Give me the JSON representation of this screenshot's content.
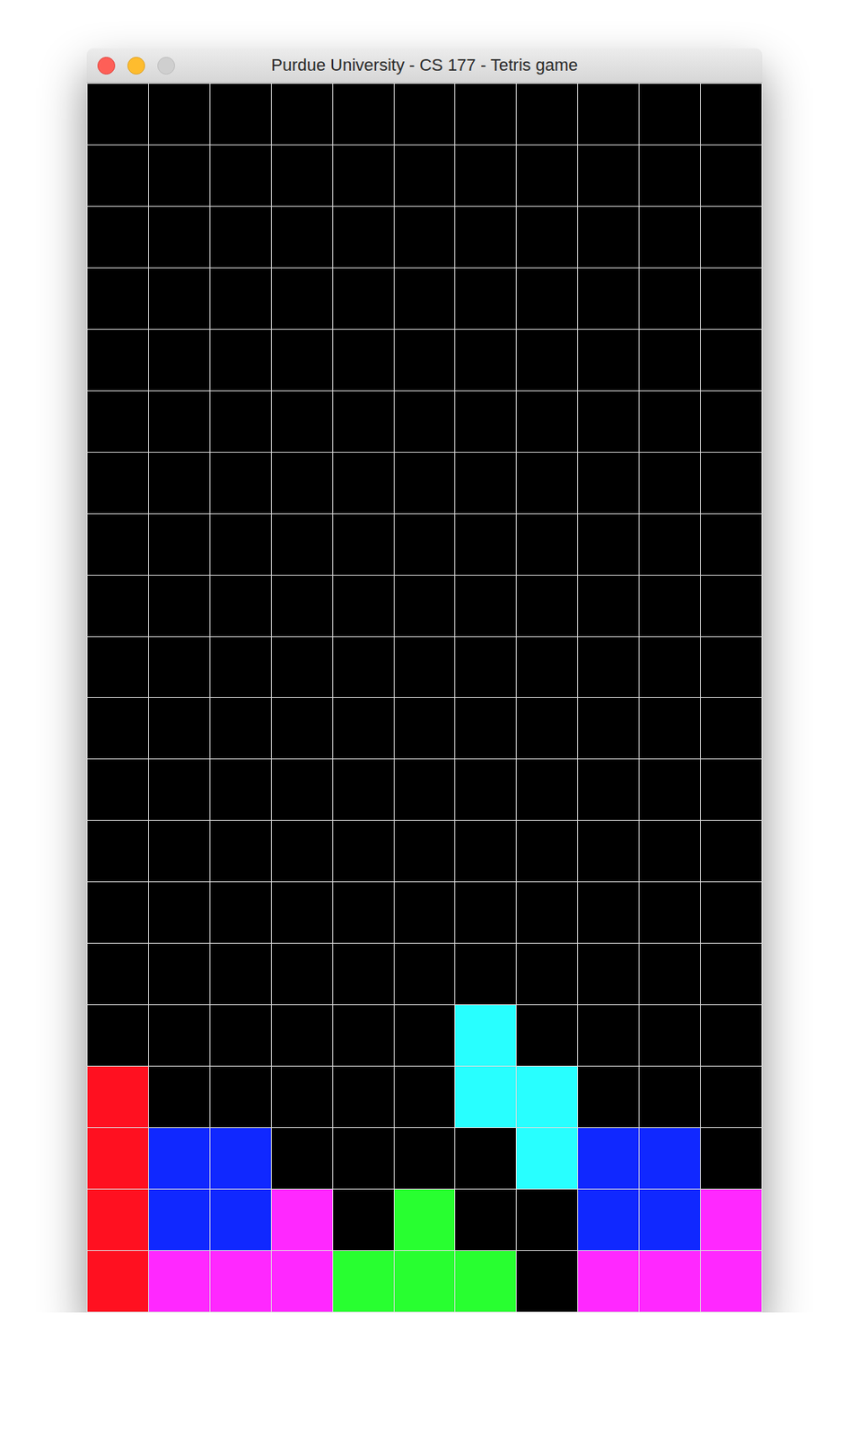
{
  "window": {
    "title": "Purdue University - CS 177 - Tetris game"
  },
  "board": {
    "rows": [
      [
        "#000000",
        "#000000",
        "#000000",
        "#000000",
        "#000000",
        "#000000",
        "#000000",
        "#000000",
        "#000000",
        "#000000",
        "#000000"
      ],
      [
        "#000000",
        "#000000",
        "#000000",
        "#000000",
        "#000000",
        "#000000",
        "#000000",
        "#000000",
        "#000000",
        "#000000",
        "#000000"
      ],
      [
        "#000000",
        "#000000",
        "#000000",
        "#000000",
        "#000000",
        "#000000",
        "#000000",
        "#000000",
        "#000000",
        "#000000",
        "#000000"
      ],
      [
        "#000000",
        "#000000",
        "#000000",
        "#000000",
        "#000000",
        "#000000",
        "#000000",
        "#000000",
        "#000000",
        "#000000",
        "#000000"
      ],
      [
        "#000000",
        "#000000",
        "#000000",
        "#000000",
        "#000000",
        "#000000",
        "#000000",
        "#000000",
        "#000000",
        "#000000",
        "#000000"
      ],
      [
        "#000000",
        "#000000",
        "#000000",
        "#000000",
        "#000000",
        "#000000",
        "#000000",
        "#000000",
        "#000000",
        "#000000",
        "#000000"
      ],
      [
        "#000000",
        "#000000",
        "#000000",
        "#000000",
        "#000000",
        "#000000",
        "#000000",
        "#000000",
        "#000000",
        "#000000",
        "#000000"
      ],
      [
        "#000000",
        "#000000",
        "#000000",
        "#000000",
        "#000000",
        "#000000",
        "#000000",
        "#000000",
        "#000000",
        "#000000",
        "#000000"
      ],
      [
        "#000000",
        "#000000",
        "#000000",
        "#000000",
        "#000000",
        "#000000",
        "#000000",
        "#000000",
        "#000000",
        "#000000",
        "#000000"
      ],
      [
        "#000000",
        "#000000",
        "#000000",
        "#000000",
        "#000000",
        "#000000",
        "#000000",
        "#000000",
        "#000000",
        "#000000",
        "#000000"
      ],
      [
        "#000000",
        "#000000",
        "#000000",
        "#000000",
        "#000000",
        "#000000",
        "#000000",
        "#000000",
        "#000000",
        "#000000",
        "#000000"
      ],
      [
        "#000000",
        "#000000",
        "#000000",
        "#000000",
        "#000000",
        "#000000",
        "#000000",
        "#000000",
        "#000000",
        "#000000",
        "#000000"
      ],
      [
        "#000000",
        "#000000",
        "#000000",
        "#000000",
        "#000000",
        "#000000",
        "#000000",
        "#000000",
        "#000000",
        "#000000",
        "#000000"
      ],
      [
        "#000000",
        "#000000",
        "#000000",
        "#000000",
        "#000000",
        "#000000",
        "#000000",
        "#000000",
        "#000000",
        "#000000",
        "#000000"
      ],
      [
        "#000000",
        "#000000",
        "#000000",
        "#000000",
        "#000000",
        "#000000",
        "#000000",
        "#000000",
        "#000000",
        "#000000",
        "#000000"
      ],
      [
        "#000000",
        "#000000",
        "#000000",
        "#000000",
        "#000000",
        "#000000",
        "#28ffff",
        "#000000",
        "#000000",
        "#000000",
        "#000000"
      ],
      [
        "#ff1020",
        "#000000",
        "#000000",
        "#000000",
        "#000000",
        "#000000",
        "#28ffff",
        "#28ffff",
        "#000000",
        "#000000",
        "#000000"
      ],
      [
        "#ff1020",
        "#1028ff",
        "#1028ff",
        "#000000",
        "#000000",
        "#000000",
        "#000000",
        "#28ffff",
        "#1028ff",
        "#1028ff",
        "#000000"
      ],
      [
        "#ff1020",
        "#1028ff",
        "#1028ff",
        "#ff28ff",
        "#000000",
        "#28ff30",
        "#000000",
        "#000000",
        "#1028ff",
        "#1028ff",
        "#ff28ff"
      ],
      [
        "#ff1020",
        "#ff28ff",
        "#ff28ff",
        "#ff28ff",
        "#28ff30",
        "#28ff30",
        "#28ff30",
        "#000000",
        "#ff28ff",
        "#ff28ff",
        "#ff28ff"
      ]
    ]
  }
}
